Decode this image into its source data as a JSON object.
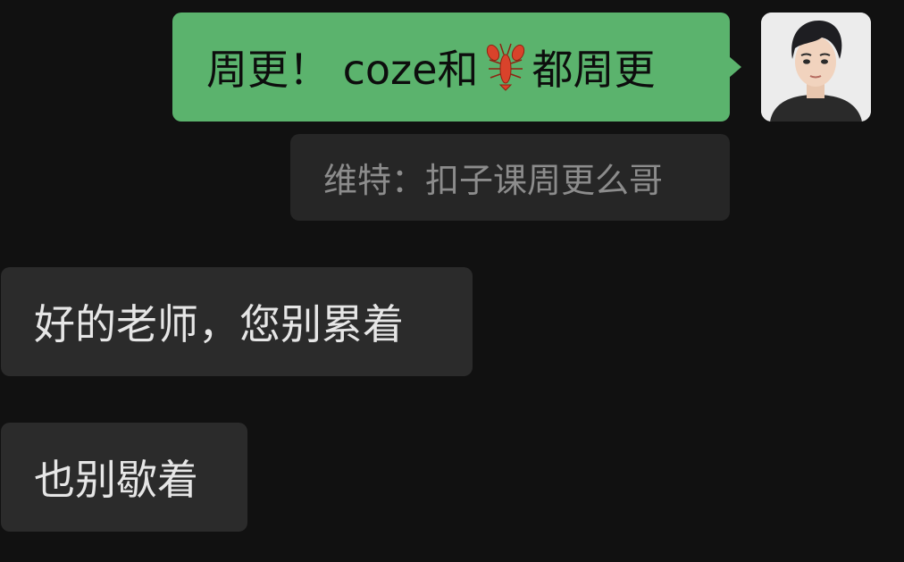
{
  "conversation": {
    "outgoing": {
      "text_before": "周更！ coze和",
      "emoji": "lobster",
      "text_after": "都周更"
    },
    "quote": {
      "text": "维特：扣子课周更么哥"
    },
    "incoming": [
      {
        "text": "好的老师，您别累着"
      },
      {
        "text": "也别歇着"
      }
    ]
  },
  "colors": {
    "background": "#111111",
    "outgoing_bubble": "#5bb36d",
    "incoming_bubble": "#2b2b2b",
    "quote_bubble": "#262626",
    "quote_text": "#8c8c8c"
  }
}
